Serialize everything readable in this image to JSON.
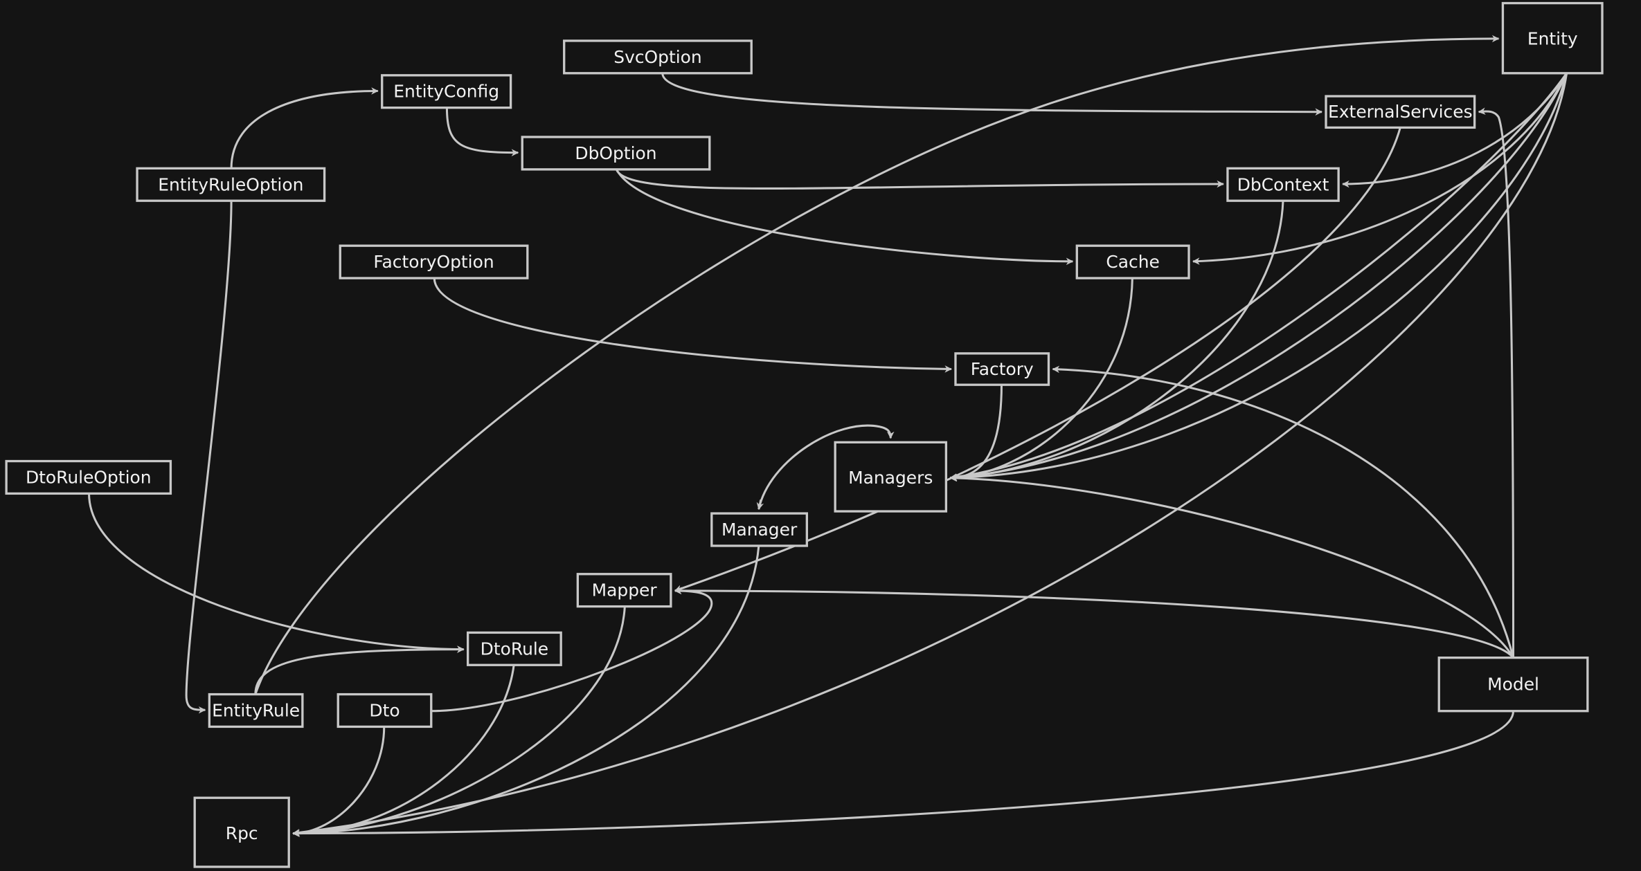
{
  "diagram": {
    "colors": {
      "background": "#141414",
      "stroke": "#c8c8c8",
      "text": "#f2f2f2"
    },
    "nodes": {
      "entity": "Entity",
      "svc_option": "SvcOption",
      "external_services": "ExternalServices",
      "entity_config": "EntityConfig",
      "db_option": "DbOption",
      "entity_rule_option": "EntityRuleOption",
      "db_context": "DbContext",
      "factory_option": "FactoryOption",
      "cache": "Cache",
      "factory": "Factory",
      "dto_rule_option": "DtoRuleOption",
      "managers": "Managers",
      "manager": "Manager",
      "mapper": "Mapper",
      "dto_rule": "DtoRule",
      "entity_rule": "EntityRule",
      "dto": "Dto",
      "model": "Model",
      "rpc": "Rpc"
    },
    "edges": [
      [
        "SvcOption",
        "ExternalServices"
      ],
      [
        "EntityRuleOption",
        "EntityConfig"
      ],
      [
        "EntityConfig",
        "DbOption"
      ],
      [
        "DbOption",
        "DbContext"
      ],
      [
        "DbOption",
        "Cache"
      ],
      [
        "EntityRuleOption",
        "EntityRule"
      ],
      [
        "FactoryOption",
        "Factory"
      ],
      [
        "Entity",
        "DbContext"
      ],
      [
        "Entity",
        "Cache"
      ],
      [
        "Entity",
        "Managers"
      ],
      [
        "Entity",
        "Mapper"
      ],
      [
        "Entity",
        "Rpc"
      ],
      [
        "ExternalServices",
        "Managers"
      ],
      [
        "DbContext",
        "Managers"
      ],
      [
        "Cache",
        "Managers"
      ],
      [
        "Factory",
        "Managers"
      ],
      [
        "Manager",
        "Managers"
      ],
      [
        "Managers",
        "Manager"
      ],
      [
        "Model",
        "ExternalServices"
      ],
      [
        "Model",
        "Factory"
      ],
      [
        "Model",
        "Managers"
      ],
      [
        "Model",
        "Mapper"
      ],
      [
        "Model",
        "Rpc"
      ],
      [
        "DtoRuleOption",
        "DtoRule"
      ],
      [
        "EntityRule",
        "DtoRule"
      ],
      [
        "EntityRule",
        "Entity"
      ],
      [
        "Dto",
        "Mapper"
      ],
      [
        "Dto",
        "Rpc"
      ],
      [
        "DtoRule",
        "Rpc"
      ],
      [
        "Mapper",
        "Rpc"
      ],
      [
        "Manager",
        "Rpc"
      ]
    ]
  }
}
